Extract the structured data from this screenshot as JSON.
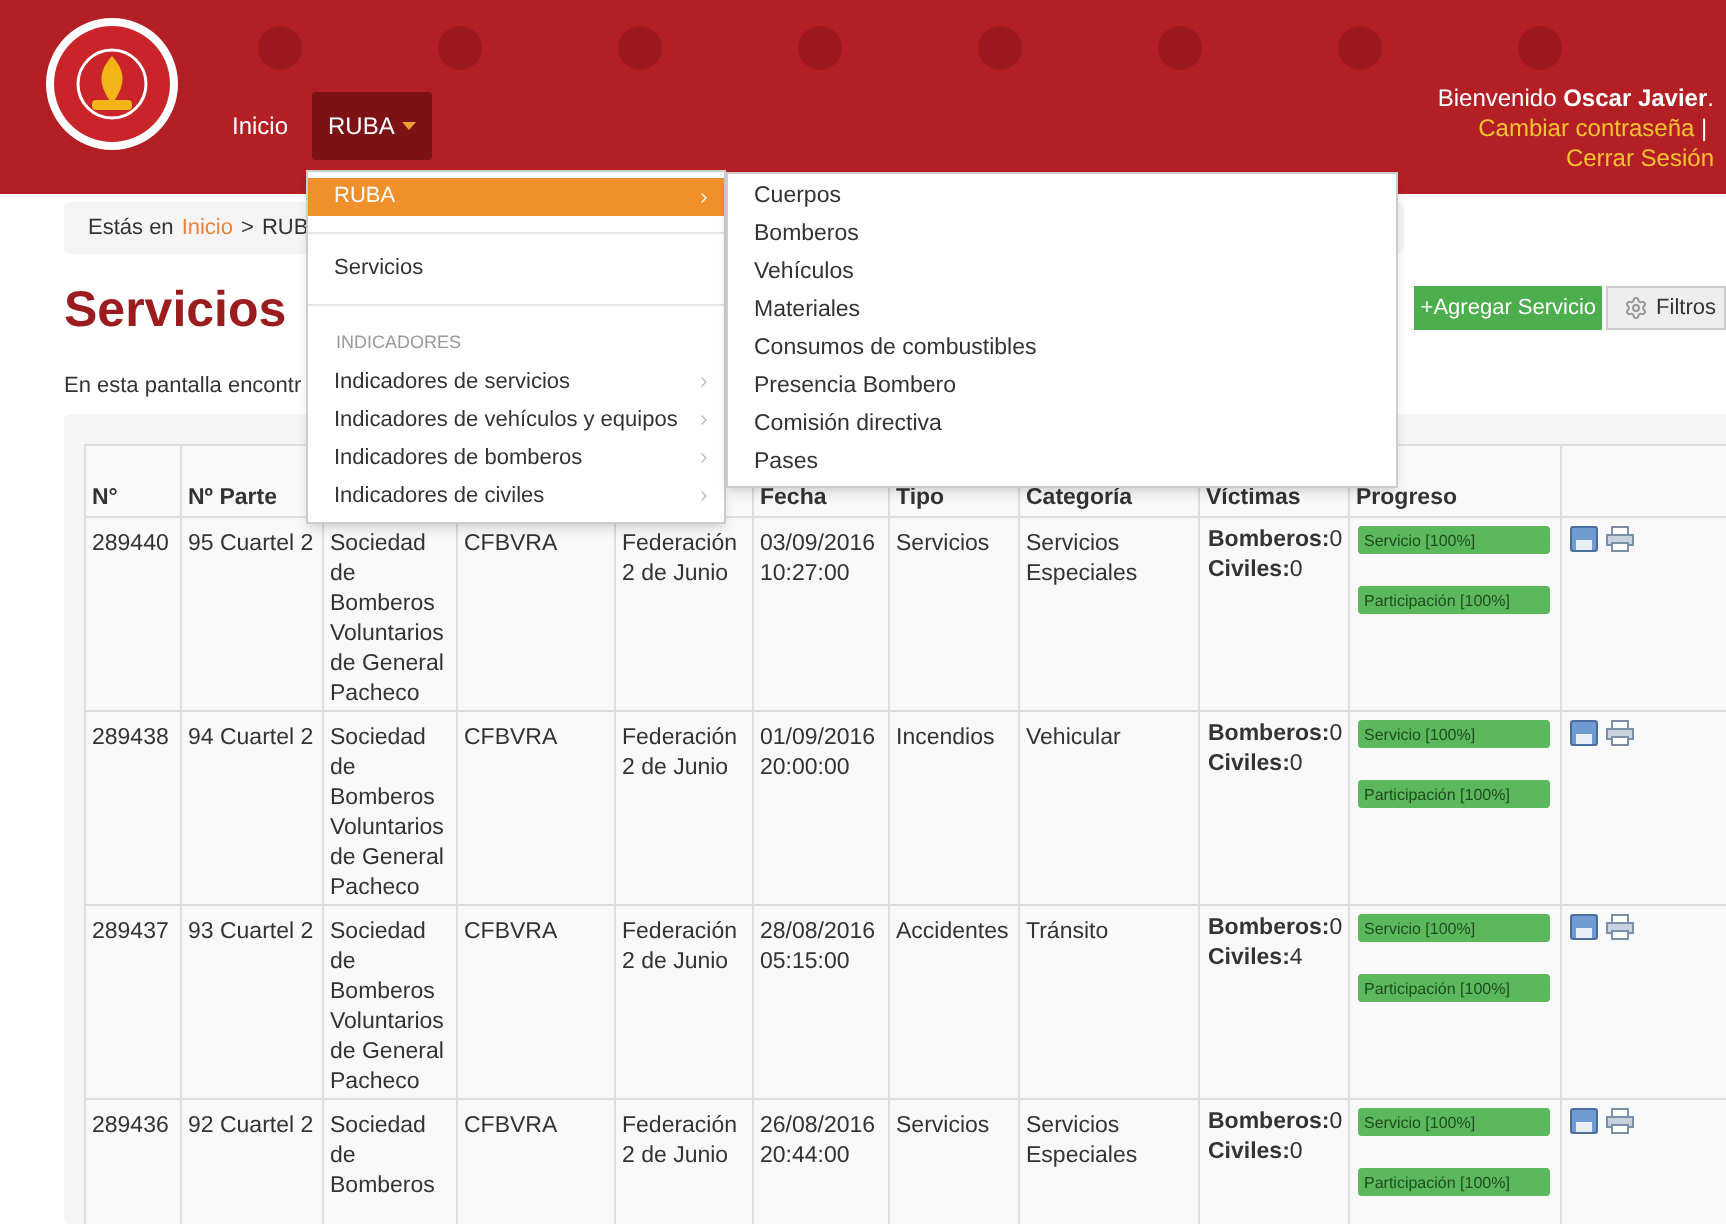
{
  "header": {
    "nav": [
      {
        "label": "Inicio",
        "selected": false,
        "has_caret": false
      },
      {
        "label": "RUBA",
        "selected": true,
        "has_caret": true
      }
    ],
    "welcome": "Bienvenido",
    "user": "Oscar Javier",
    "user_end": ".",
    "change_password": "Cambiar contraseña",
    "separator": "|",
    "logout": "Cerrar Sesión"
  },
  "breadcrumb": {
    "prefix": "Estás en",
    "home": "Inicio",
    "separator": ">",
    "current": "RUB"
  },
  "dropdown": {
    "items": [
      {
        "kind": "item",
        "label": "RUBA",
        "selected": true,
        "has_submenu": true
      },
      {
        "kind": "divider"
      },
      {
        "kind": "item",
        "label": "Servicios",
        "selected": false,
        "has_submenu": false
      },
      {
        "kind": "divider"
      },
      {
        "kind": "header",
        "label": "INDICADORES"
      },
      {
        "kind": "item",
        "label": "Indicadores de servicios",
        "selected": false,
        "has_submenu": true
      },
      {
        "kind": "item",
        "label": "Indicadores de vehículos y equipos",
        "selected": false,
        "has_submenu": true
      },
      {
        "kind": "item",
        "label": "Indicadores de bomberos",
        "selected": false,
        "has_submenu": true
      },
      {
        "kind": "item",
        "label": "Indicadores de civiles",
        "selected": false,
        "has_submenu": true
      }
    ],
    "submenu": [
      "Cuerpos",
      "Bomberos",
      "Vehículos",
      "Materiales",
      "Consumos de combustibles",
      "Presencia Bombero",
      "Comisión directiva",
      "Pases"
    ]
  },
  "page": {
    "title": "Servicios",
    "description": "En esta pantalla encontr",
    "add_button": "+Agregar Servicio",
    "filter_button": "Filtros"
  },
  "table": {
    "columns": [
      "N°",
      "Nº Parte",
      null,
      null,
      null,
      "Fecha",
      "Tipo",
      "Categoría",
      "Víctimas",
      "Progreso",
      null
    ],
    "rows": [
      {
        "cells": [
          "289440",
          "95 Cuartel 2",
          "Sociedad de Bomberos Voluntarios de General Pacheco",
          "CFBVRA",
          "Federación 2 de Junio",
          "03/09/2016 10:27:00",
          "Servicios",
          "Servicios Especiales"
        ],
        "victims": [
          {
            "label": "Bomberos:",
            "value": "0"
          },
          {
            "label": "Civiles:",
            "value": "0"
          }
        ],
        "progress": [
          {
            "label": "Servicio [100%]",
            "level": 1
          },
          {
            "label": "Participación [100%]",
            "level": 1
          }
        ]
      },
      {
        "cells": [
          "289438",
          "94 Cuartel 2",
          "Sociedad de Bomberos Voluntarios de General Pacheco",
          "CFBVRA",
          "Federación 2 de Junio",
          "01/09/2016 20:00:00",
          "Incendios",
          "Vehicular"
        ],
        "victims": [
          {
            "label": "Bomberos:",
            "value": "0"
          },
          {
            "label": "Civiles:",
            "value": "0"
          }
        ],
        "progress": [
          {
            "label": "Servicio [100%]",
            "level": 1
          },
          {
            "label": "Participación [100%]",
            "level": 1
          }
        ]
      },
      {
        "cells": [
          "289437",
          "93 Cuartel 2",
          "Sociedad de Bomberos Voluntarios de General Pacheco",
          "CFBVRA",
          "Federación 2 de Junio",
          "28/08/2016 05:15:00",
          "Accidentes",
          "Tránsito"
        ],
        "victims": [
          {
            "label": "Bomberos:",
            "value": "0"
          },
          {
            "label": "Civiles:",
            "value": "4"
          }
        ],
        "progress": [
          {
            "label": "Servicio [100%]",
            "level": 1
          },
          {
            "label": "Participación [100%]",
            "level": 1
          }
        ]
      },
      {
        "cells": [
          "289436",
          "92 Cuartel 2",
          "Sociedad de Bomberos",
          "CFBVRA",
          "Federación 2 de Junio",
          "26/08/2016 20:44:00",
          "Servicios",
          "Servicios Especiales"
        ],
        "victims": [
          {
            "label": "Bomberos:",
            "value": "0"
          },
          {
            "label": "Civiles:",
            "value": "0"
          }
        ],
        "progress": [
          {
            "label": "Servicio [100%]",
            "level": 1
          },
          {
            "label": "Participación [100%]",
            "level": 1
          }
        ]
      }
    ]
  }
}
